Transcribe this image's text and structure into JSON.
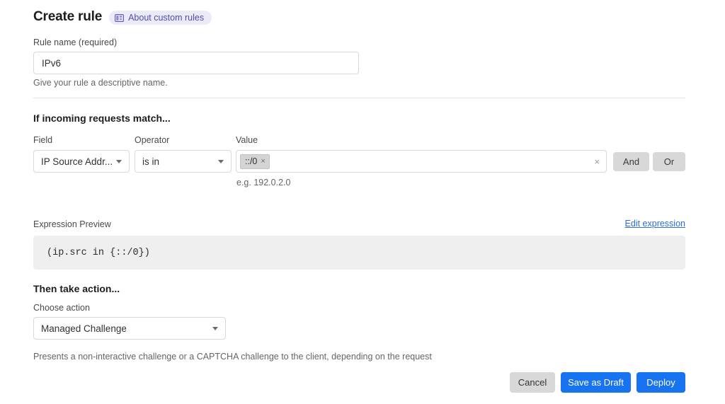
{
  "header": {
    "title": "Create rule",
    "about_badge": {
      "label": "About custom rules",
      "icon": "book-panel-icon"
    }
  },
  "rule_name": {
    "label": "Rule name (required)",
    "value": "IPv6",
    "placeholder": "",
    "helper": "Give your rule a descriptive name."
  },
  "match_section": {
    "heading": "If incoming requests match...",
    "field": {
      "label": "Field",
      "selected": "IP Source Addr..."
    },
    "operator": {
      "label": "Operator",
      "selected": "is in"
    },
    "value": {
      "label": "Value",
      "chips": [
        "::/0"
      ],
      "chip_remove_icon": "×",
      "clear_icon": "×",
      "helper": "e.g. 192.0.2.0"
    },
    "logic_buttons": {
      "and": "And",
      "or": "Or"
    }
  },
  "expression": {
    "label": "Expression Preview",
    "edit_link": "Edit expression",
    "text": "(ip.src in {::/0})"
  },
  "action_section": {
    "heading": "Then take action...",
    "label": "Choose action",
    "selected": "Managed Challenge",
    "description": "Presents a non-interactive challenge or a CAPTCHA challenge to the client, depending on the request"
  },
  "footer": {
    "cancel": "Cancel",
    "save_draft": "Save as Draft",
    "deploy": "Deploy"
  },
  "colors": {
    "primary_blue": "#1873f0",
    "link_blue": "#2b6cdb",
    "badge_bg": "#ebeaf8",
    "badge_text": "#4f4fa8",
    "neutral_button": "#d8d8d8",
    "expr_bg": "#efefef"
  }
}
